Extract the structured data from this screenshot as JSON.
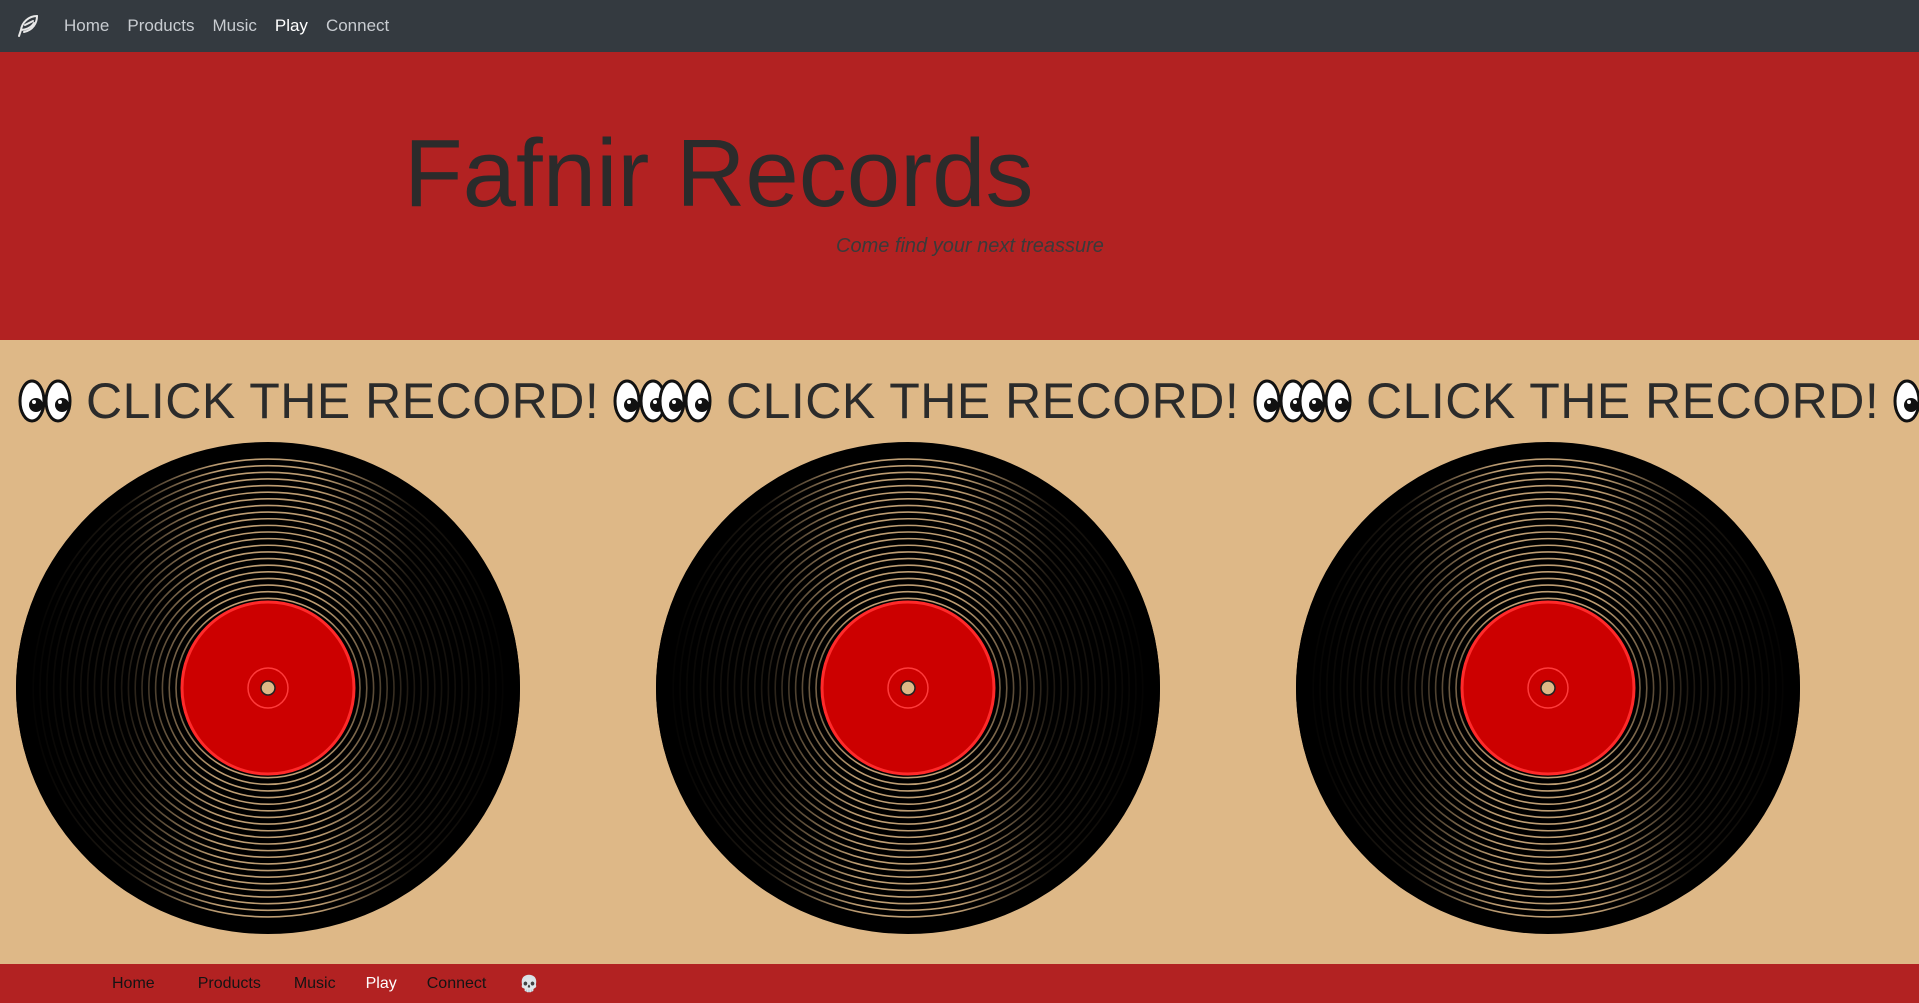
{
  "nav": {
    "brand_icon": "feather-icon",
    "items": [
      {
        "label": "Home"
      },
      {
        "label": "Products"
      },
      {
        "label": "Music"
      },
      {
        "label": "Play"
      },
      {
        "label": "Connect"
      }
    ],
    "active": "Play"
  },
  "hero": {
    "title": "Fafnir Records",
    "subtitle": "Come find your next treassure"
  },
  "records": [
    {
      "heading": "CLICK THE RECORD!",
      "left_icon": "eyes-icon",
      "right_icon": "eyes-icon"
    },
    {
      "heading": "CLICK THE RECORD!",
      "left_icon": "eyes-icon",
      "right_icon": "eyes-icon"
    },
    {
      "heading": "CLICK THE RECORD!",
      "left_icon": "eyes-icon",
      "right_icon": "eyes-icon"
    }
  ],
  "footer": {
    "items": [
      {
        "label": "Home"
      },
      {
        "label": "Products"
      },
      {
        "label": "Music"
      },
      {
        "label": "Play"
      },
      {
        "label": "Connect"
      }
    ],
    "skull": "💀"
  },
  "colors": {
    "topnav_bg": "#343a40",
    "hero_bg": "#b22222",
    "section_bg": "#deb887",
    "label_red": "#cc0000"
  }
}
